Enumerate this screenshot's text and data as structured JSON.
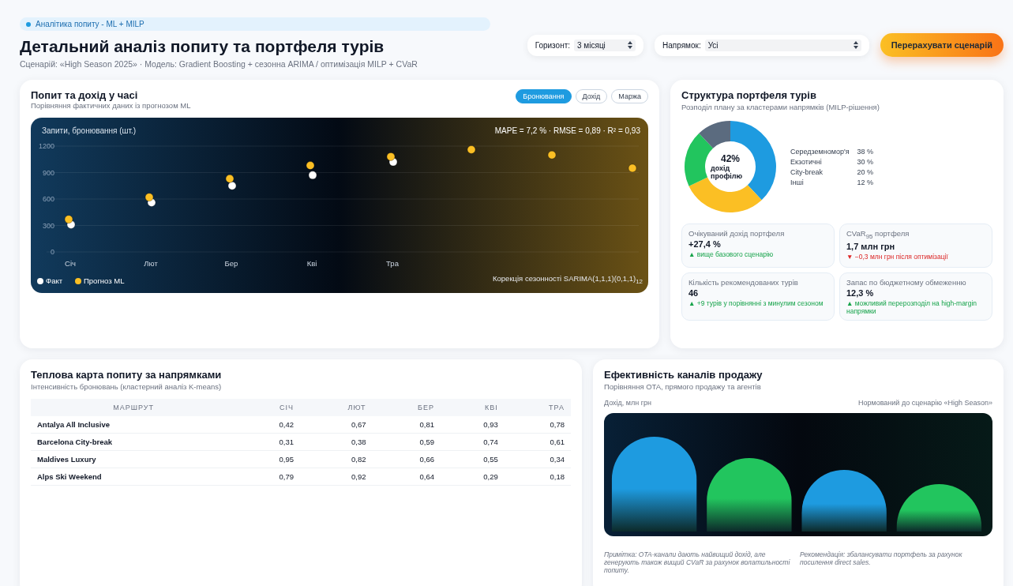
{
  "header": {
    "badge": "Аналітика попиту - ML + MILP",
    "title": "Детальний аналіз попиту та портфеля турів",
    "subtitle": "Сценарій: «High Season 2025» · Модель: Gradient Boosting + сезонна ARIMA / оптимізація MILP + CVaR"
  },
  "controls": [
    {
      "label": "Горизонт:",
      "value": "3 місяці"
    },
    {
      "label": "Напрямок:",
      "value": "Усі"
    }
  ],
  "action_button": "Перерахувати сценарій",
  "demand_card": {
    "title": "Попит та дохід у часі",
    "subtitle": "Порівняння фактичних даних із прогнозом ML",
    "tabs": [
      {
        "label": "Бронювання",
        "selected": true
      },
      {
        "label": "Дохід",
        "selected": false
      },
      {
        "label": "Маржа",
        "selected": false
      }
    ],
    "metrics": "MAPE = 7,2 % · RMSE = 0,89 · R² = 0,93",
    "annotation": "Корекція сезонності SARIMA(1,1,1)(0,1,1)$_{12}$",
    "chart_data": {
      "type": "scatter",
      "ylabel": "Запити, бронювання (шт.)",
      "categories": [
        "Січ",
        "Лют",
        "Бер",
        "Кві",
        "Тра",
        null,
        null,
        null
      ],
      "yticks": [
        0,
        300,
        600,
        900,
        1200
      ],
      "ylim": [
        0,
        1200
      ],
      "grid": true,
      "legend": true,
      "series": [
        {
          "name": "Факт",
          "color": "#ffffff",
          "values": [
            310,
            560,
            750,
            870,
            1020,
            null,
            null,
            null
          ]
        },
        {
          "name": "Прогноз ML",
          "color": "#fbbf24",
          "values": [
            370,
            620,
            830,
            980,
            1080,
            1160,
            1100,
            950
          ]
        }
      ]
    }
  },
  "portfolio_card": {
    "title": "Структура портфеля турів",
    "subtitle": "Розподіл плану за кластерами напрямків (MILP-рішення)",
    "center_value": "42%",
    "center_label": "дохід профілю",
    "chart_data": {
      "type": "donut",
      "categories": [
        "Середземномор'я",
        "Екзотичні",
        "City-break",
        "Інші"
      ],
      "values": [
        38,
        30,
        20,
        12
      ],
      "colors": [
        "#1e9be0",
        "#fbbf24",
        "#22c55e",
        "#5b6b7f"
      ],
      "value_labels": [
        "38 %",
        "30 %",
        "20 %",
        "12 %"
      ]
    },
    "kpis": [
      {
        "label": "Очікуваний дохід портфеля",
        "value": "+27,4 %",
        "positive": true,
        "note": "▲ вище базового сценарію"
      },
      {
        "label": "CVaR$_{95}$ портфеля",
        "value": "1,7 млн грн",
        "positive": false,
        "note": "▼ −0,3 млн грн після оптимізації"
      },
      {
        "label": "Кількість рекомендованих турів",
        "value": "46",
        "positive": true,
        "note": "▲ +9 турів у порівнянні з минулим сезоном"
      },
      {
        "label": "Запас по бюджетному обмеженню",
        "value": "12,3 %",
        "positive": true,
        "note": "▲ можливий перерозподіл на high-margin напрямки"
      }
    ]
  },
  "heatmap_card": {
    "title": "Теплова карта попиту за напрямками",
    "subtitle": "Інтенсивність бронювань (кластерний аналіз K-means)",
    "columns": [
      "МАРШРУТ",
      "СІЧ",
      "ЛЮТ",
      "БЕР",
      "КВІ",
      "ТРА"
    ],
    "rows": [
      [
        "Antalya All Inclusive",
        "0,42",
        "0,67",
        "0,81",
        "0,93",
        "0,78"
      ],
      [
        "Barcelona City-break",
        "0,31",
        "0,38",
        "0,59",
        "0,74",
        "0,61"
      ],
      [
        "Maldives Luxury",
        "0,95",
        "0,82",
        "0,66",
        "0,55",
        "0,34"
      ],
      [
        "Alps Ski Weekend",
        "0,79",
        "0,92",
        "0,64",
        "0,29",
        "0,18"
      ]
    ]
  },
  "channels_card": {
    "title": "Ефективність каналів продажу",
    "subtitle": "Порівняння OTA, прямого продажу та агентів",
    "axis_label": "Дохід, млн грн",
    "norm_label": "Нормований до сценарію «High Season»",
    "bars": [
      {
        "color": "#1e9be0"
      },
      {
        "color": "#22c55e"
      },
      {
        "color": "#1e9be0"
      },
      {
        "color": "#22c55e"
      }
    ],
    "notes": [
      "Примітка: OTA-канали дають найвищий дохід, але генерують також вищий CVaR за рахунок волатильності попиту.",
      "Рекомендація: збалансувати портфель за рахунок посилення direct sales."
    ]
  }
}
